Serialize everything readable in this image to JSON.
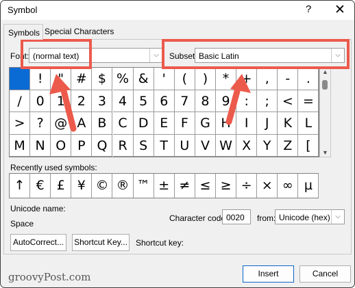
{
  "window": {
    "title": "Symbol",
    "help": "?",
    "close": "✕"
  },
  "tabs": [
    {
      "label": "Symbols"
    },
    {
      "label": "Special Characters"
    }
  ],
  "font": {
    "label": "Font:",
    "value": "(normal text)"
  },
  "subset": {
    "label": "Subset:",
    "value": "Basic Latin"
  },
  "symbols": [
    "",
    "!",
    "\"",
    "#",
    "$",
    "%",
    "&",
    "'",
    "(",
    ")",
    "*",
    "+",
    ",",
    "-",
    ".",
    "/",
    "0",
    "1",
    "2",
    "3",
    "4",
    "5",
    "6",
    "7",
    "8",
    "9",
    ":",
    ";",
    "<",
    "=",
    ">",
    "?",
    "@",
    "A",
    "B",
    "C",
    "D",
    "E",
    "F",
    "G",
    "H",
    "I",
    "J",
    "K",
    "L",
    "M",
    "N",
    "O",
    "P",
    "Q",
    "R",
    "S",
    "T",
    "U",
    "V",
    "W",
    "X",
    "Y",
    "Z",
    "["
  ],
  "recent": {
    "label": "Recently used symbols:",
    "symbols": [
      "↑",
      "€",
      "£",
      "¥",
      "©",
      "®",
      "™",
      "±",
      "≠",
      "≤",
      "≥",
      "÷",
      "×",
      "∞",
      "µ"
    ]
  },
  "unicode": {
    "label": "Unicode name:",
    "value": "Space"
  },
  "charcode": {
    "label": "Character code:",
    "value": "0020",
    "from_label": "from:",
    "from_value": "Unicode (hex)"
  },
  "buttons": {
    "autocorrect": "AutoCorrect...",
    "shortcut_key": "Shortcut Key...",
    "shortcut_label": "Shortcut key:",
    "insert": "Insert",
    "cancel": "Cancel"
  },
  "watermark": "groovyPost.com",
  "colors": {
    "highlight": "#ec5a4c",
    "selection": "#0a6bd4"
  }
}
